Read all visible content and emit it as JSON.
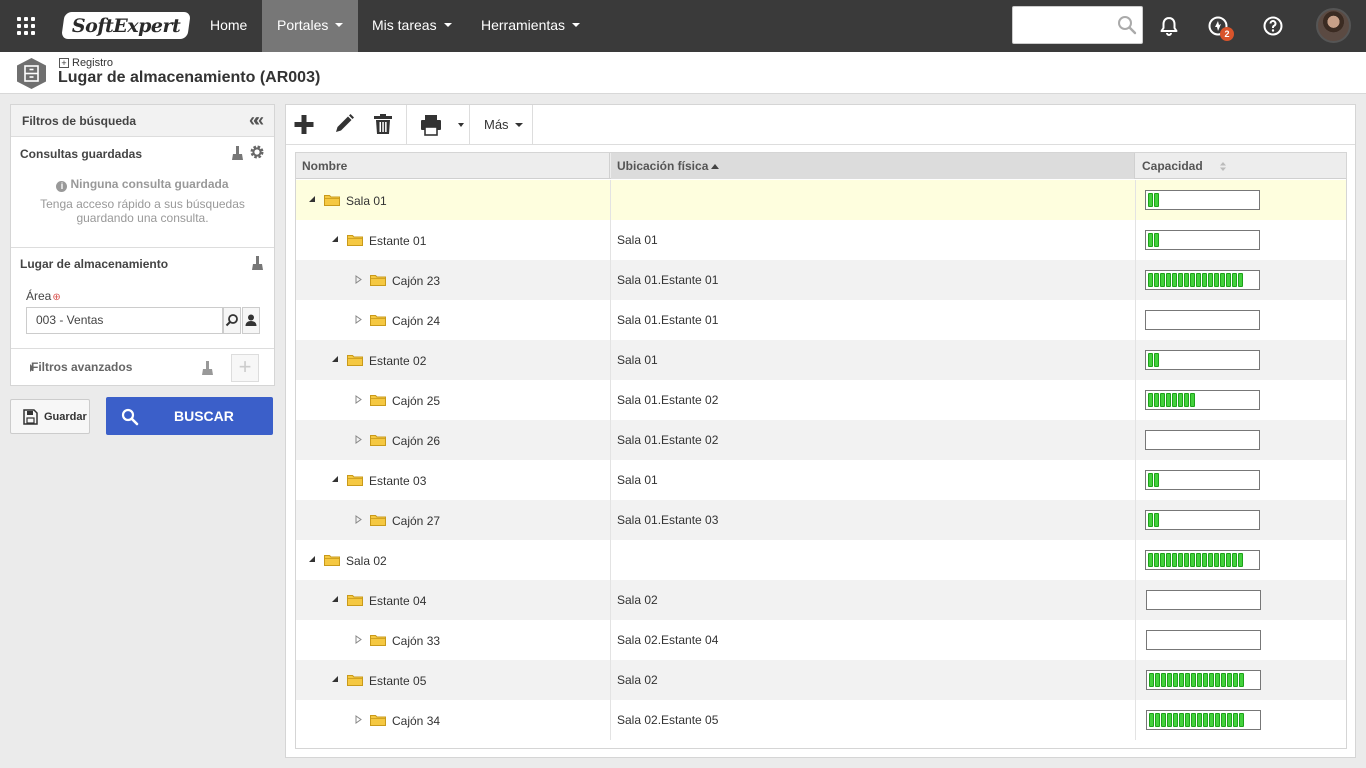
{
  "topbar": {
    "logo_text": "SoftExpert",
    "nav": [
      {
        "label": "Home",
        "has_menu": false
      },
      {
        "label": "Portales",
        "has_menu": true,
        "active": true
      },
      {
        "label": "Mis tareas",
        "has_menu": true
      },
      {
        "label": "Herramientas",
        "has_menu": true
      }
    ],
    "search_value": "",
    "notification_badge": "2",
    "icons": [
      "apps-grid-icon",
      "search-icon",
      "bell-icon",
      "tasks-icon",
      "help-icon",
      "user-avatar"
    ]
  },
  "header": {
    "breadcrumb": "Registro",
    "title": "Lugar de almacenamiento (AR003)"
  },
  "filters": {
    "title": "Filtros de búsqueda",
    "saved": {
      "title": "Consultas guardadas",
      "empty_title": "Ninguna consulta guardada",
      "empty_desc": "Tenga acceso rápido a sus búsquedas guardando una consulta."
    },
    "location": {
      "title": "Lugar de almacenamiento",
      "area_label": "Área",
      "area_value": "003 - Ventas"
    },
    "advanced_title": "Filtros avanzados",
    "save_label": "Guardar",
    "search_label": "BUSCAR"
  },
  "toolbar": {
    "more_label": "Más"
  },
  "grid": {
    "columns": {
      "name": "Nombre",
      "location": "Ubicación física",
      "capacity": "Capacidad"
    },
    "rows": [
      {
        "name": "Sala 01",
        "level": 0,
        "expanded": true,
        "location": "",
        "capacity_segments": 2,
        "selected": true
      },
      {
        "name": "Estante 01",
        "level": 1,
        "expanded": true,
        "location": "Sala 01",
        "capacity_segments": 2
      },
      {
        "name": "Cajón 23",
        "level": 2,
        "expanded": false,
        "location": "Sala 01.Estante 01",
        "capacity_segments": 16
      },
      {
        "name": "Cajón 24",
        "level": 2,
        "expanded": false,
        "location": "Sala 01.Estante 01",
        "capacity_segments": 0
      },
      {
        "name": "Estante 02",
        "level": 1,
        "expanded": true,
        "location": "Sala 01",
        "capacity_segments": 2
      },
      {
        "name": "Cajón 25",
        "level": 2,
        "expanded": false,
        "location": "Sala 01.Estante 02",
        "capacity_segments": 8
      },
      {
        "name": "Cajón 26",
        "level": 2,
        "expanded": false,
        "location": "Sala 01.Estante 02",
        "capacity_segments": 0
      },
      {
        "name": "Estante 03",
        "level": 1,
        "expanded": true,
        "location": "Sala 01",
        "capacity_segments": 2
      },
      {
        "name": "Cajón 27",
        "level": 2,
        "expanded": false,
        "location": "Sala 01.Estante 03",
        "capacity_segments": 2
      },
      {
        "name": "Sala 02",
        "level": 0,
        "expanded": true,
        "location": "",
        "capacity_segments": 16
      },
      {
        "name": "Estante 04",
        "level": 1,
        "expanded": true,
        "location": "Sala 02",
        "capacity_segments": 0
      },
      {
        "name": "Cajón 33",
        "level": 2,
        "expanded": false,
        "location": "Sala 02.Estante 04",
        "capacity_segments": 0
      },
      {
        "name": "Estante 05",
        "level": 1,
        "expanded": true,
        "location": "Sala 02",
        "capacity_segments": 16
      },
      {
        "name": "Cajón 34",
        "level": 2,
        "expanded": false,
        "location": "Sala 02.Estante 05",
        "capacity_segments": 16
      }
    ]
  },
  "colors": {
    "topbar": "#3a3a3a",
    "primary_button": "#3b5fc9",
    "capacity_fill": "#43d13c",
    "selected_row": "#fefede",
    "folder": "#f5c842"
  }
}
